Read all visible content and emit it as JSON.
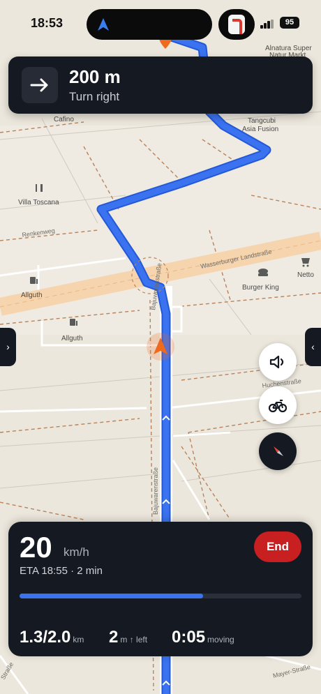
{
  "status_bar": {
    "time": "18:53",
    "battery": "95"
  },
  "map": {
    "labels": {
      "cafino": "Cafino",
      "villa_toscana": "Villa Toscana",
      "allguth_1": "Allguth",
      "allguth_2": "Allguth",
      "tangcubi": "Tangcubi",
      "asia_fusion": "Asia Fusion",
      "burger_king": "Burger King",
      "netto": "Netto",
      "alnatura_1": "Alnatura Super",
      "alnatura_2": "Natur Markt"
    },
    "streets": {
      "renkenweg": "Renkenweg",
      "wasserburger": "Wasserburger Landstraße",
      "huchenstrasse": "Huchenstraße",
      "bajuwarenstrasse": "Bajuwarenstraße",
      "mayer": "Mayer-Straße",
      "strasse_left": "Straße",
      "bajuwarenstrasse_top": "Bajuwarenstraße"
    },
    "route_color": "#3a72ef",
    "marker_color": "#f06a1e"
  },
  "turn": {
    "distance": "200 m",
    "instruction": "Turn right",
    "icon": "arrow-right-icon"
  },
  "trip": {
    "speed": "20",
    "speed_unit": "km/h",
    "eta": "ETA 18:55 · 2 min",
    "end_label": "End",
    "progress": 0.65,
    "distance_done_total": "1.3/2.0",
    "distance_unit": "km",
    "elevation": "2",
    "elevation_unit": "m ↑ left",
    "elapsed": "0:05",
    "elapsed_label": "moving"
  },
  "controls": {
    "left_handle": "›",
    "right_handle": "‹",
    "sound_icon": "speaker-icon",
    "bike_icon": "bicycle-icon",
    "compass_icon": "compass-icon"
  },
  "colors": {
    "panel": "#151922",
    "end_button": "#c81f21",
    "accent": "#3a72ef"
  }
}
